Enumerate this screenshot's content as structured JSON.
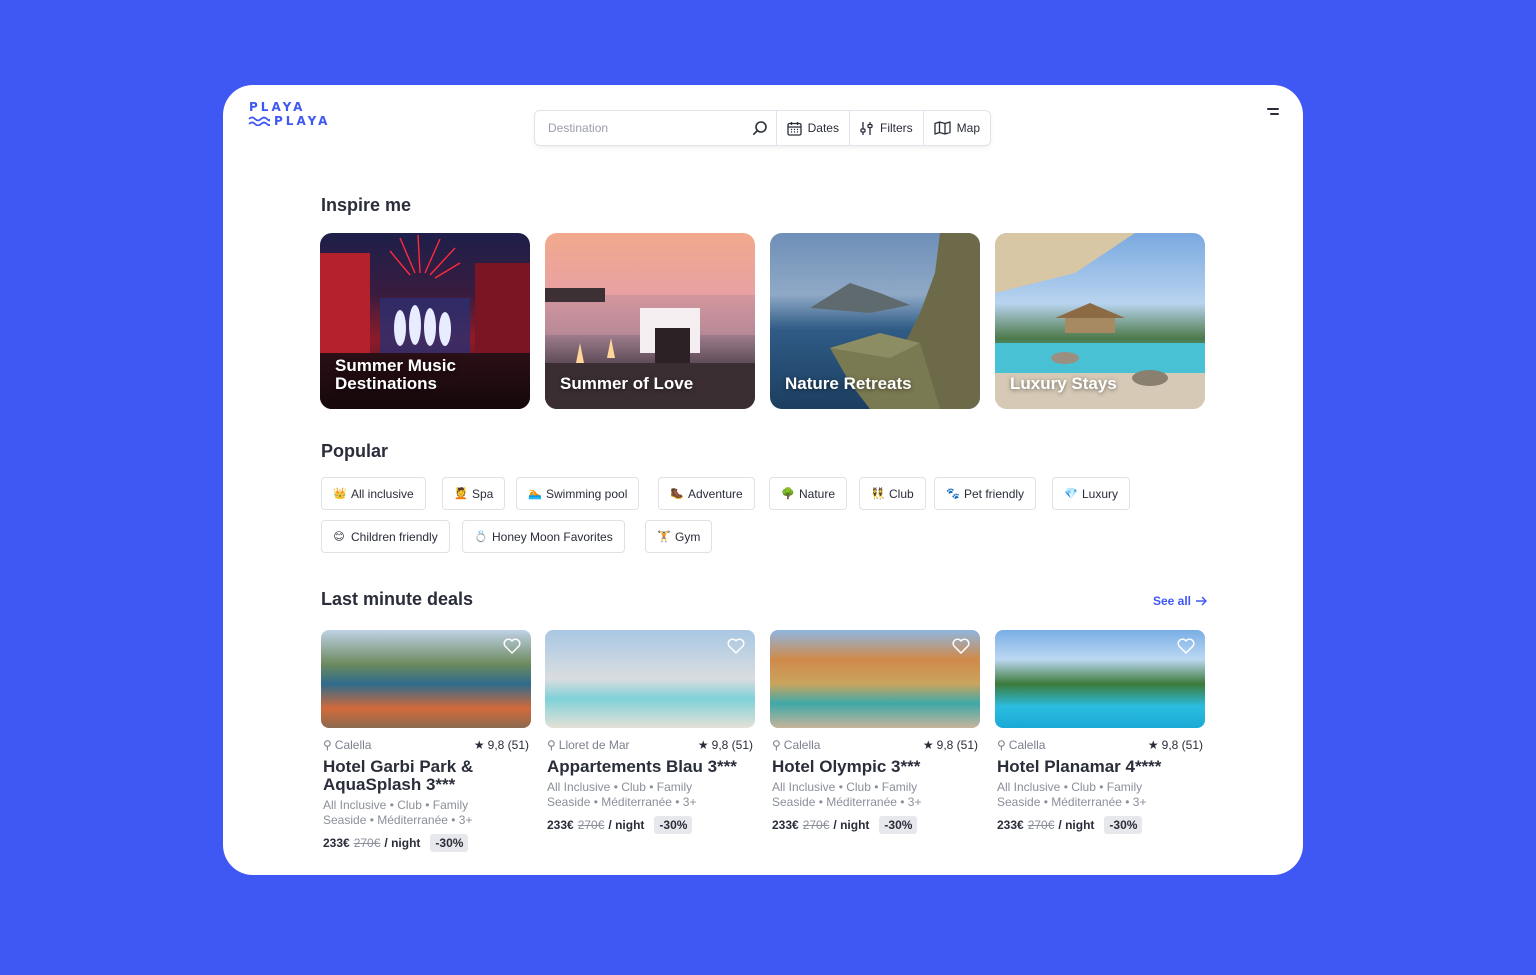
{
  "brand": {
    "line1": "PLAYA",
    "line2": "PLAYA"
  },
  "search": {
    "placeholder": "Destination",
    "dates_label": "Dates",
    "filters_label": "Filters",
    "map_label": "Map"
  },
  "inspire": {
    "title": "Inspire me",
    "cards": [
      {
        "label": "Summer Music Destinations"
      },
      {
        "label": "Summer of Love"
      },
      {
        "label": "Nature Retreats"
      },
      {
        "label": "Luxury Stays"
      }
    ]
  },
  "popular": {
    "title": "Popular",
    "chips": [
      {
        "emoji": "👑",
        "label": "All inclusive"
      },
      {
        "emoji": "💆",
        "label": "Spa"
      },
      {
        "emoji": "🏊",
        "label": "Swimming pool"
      },
      {
        "emoji": "🥾",
        "label": "Adventure"
      },
      {
        "emoji": "🌳",
        "label": "Nature"
      },
      {
        "emoji": "👯",
        "label": "Club"
      },
      {
        "emoji": "🐾",
        "label": "Pet friendly"
      },
      {
        "emoji": "💎",
        "label": "Luxury"
      },
      {
        "emoji": "😊",
        "label": "Children friendly"
      },
      {
        "emoji": "💍",
        "label": "Honey Moon Favorites"
      },
      {
        "emoji": "🏋",
        "label": "Gym"
      }
    ]
  },
  "deals": {
    "title": "Last minute deals",
    "see_all": "See all",
    "items": [
      {
        "location": "Calella",
        "rating": "9,8 (51)",
        "name": "Hotel Garbi Park & AquaSplash 3***",
        "tags1": "All Inclusive • Club • Family",
        "tags2": "Seaside • Méditerranée • 3+",
        "price": "233€",
        "old_price": "270€",
        "per": "/ night",
        "discount": "-30%"
      },
      {
        "location": "Lloret de Mar",
        "rating": "9,8 (51)",
        "name": "Appartements Blau 3***",
        "tags1": "All Inclusive • Club • Family",
        "tags2": "Seaside • Méditerranée • 3+",
        "price": "233€",
        "old_price": "270€",
        "per": "/ night",
        "discount": "-30%"
      },
      {
        "location": "Calella",
        "rating": "9,8 (51)",
        "name": "Hotel Olympic 3***",
        "tags1": "All Inclusive • Club • Family",
        "tags2": "Seaside • Méditerranée • 3+",
        "price": "233€",
        "old_price": "270€",
        "per": "/ night",
        "discount": "-30%"
      },
      {
        "location": "Calella",
        "rating": "9,8 (51)",
        "name": "Hotel Planamar 4****",
        "tags1": "All Inclusive • Club • Family",
        "tags2": "Seaside • Méditerranée • 3+",
        "price": "233€",
        "old_price": "270€",
        "per": "/ night",
        "discount": "-30%"
      }
    ]
  },
  "colors": {
    "accent": "#4058f3",
    "text": "#2a2d3a",
    "muted": "#8b8f9a"
  }
}
